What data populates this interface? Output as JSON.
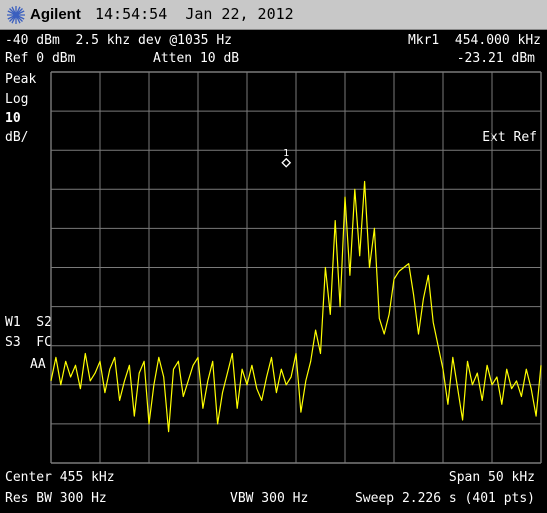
{
  "titlebar": {
    "brand": "Agilent",
    "time": "14:54:54",
    "date": "Jan 22, 2012",
    "logo_icon": "agilent-spark-icon"
  },
  "header": {
    "line1_left": "-40 dBm  2.5 khz dev @1035 Hz",
    "marker_label": "Mkr1  454.000 kHz",
    "ref_level": "Ref 0 dBm",
    "attenuation": "Atten 10 dB",
    "marker_amplitude": "-23.21 dBm"
  },
  "left_panel": {
    "detector": "Peak",
    "scale_type": "Log",
    "scale_value": "10",
    "scale_unit": "dB/",
    "trace_line1": "W1  S2",
    "trace_line2": "S3  FC",
    "trace_line3": "AA"
  },
  "right_panel": {
    "reference": "Ext Ref"
  },
  "marker": {
    "number": "1",
    "frequency_khz": 454.0,
    "amplitude_dbm": -23.21
  },
  "footer": {
    "center": "Center 455 kHz",
    "span": "Span 50 kHz",
    "rbw": "Res BW 300 Hz",
    "vbw": "VBW 300 Hz",
    "sweep": "Sweep 2.226 s (401 pts)"
  },
  "colors": {
    "trace": "#ffff00",
    "grid": "#7a7a7a",
    "background": "#000000",
    "titlebar": "#c8c8c8"
  },
  "chart_data": {
    "type": "line",
    "x_unit": "kHz",
    "y_unit": "dBm",
    "xlim": [
      430,
      480
    ],
    "ylim": [
      -100,
      0
    ],
    "x_divisions": 10,
    "y_divisions": 10,
    "grid": true,
    "series": [
      {
        "x": [
          430.0,
          430.5,
          431.0,
          431.5,
          432.0,
          432.5,
          433.0,
          433.5,
          434.0,
          434.5,
          435.0,
          435.5,
          436.0,
          436.5,
          437.0,
          437.5,
          438.0,
          438.5,
          439.0,
          439.5,
          440.0,
          440.5,
          441.0,
          441.5,
          442.0,
          442.5,
          443.0,
          443.5,
          444.0,
          444.5,
          445.0,
          445.5,
          446.0,
          446.5,
          447.0,
          447.5,
          448.0,
          448.5,
          449.0,
          449.5,
          450.0,
          450.5,
          451.0,
          451.5,
          452.0,
          452.5,
          453.0,
          453.5,
          454.0,
          454.5,
          455.0,
          455.5,
          456.0,
          456.5,
          457.0,
          457.5,
          458.0,
          458.5,
          459.0,
          459.5,
          460.0,
          460.5,
          461.0,
          461.5,
          462.0,
          462.5,
          463.0,
          463.5,
          464.0,
          464.5,
          465.0,
          465.5,
          466.0,
          466.5,
          467.0,
          467.5,
          468.0,
          468.5,
          469.0,
          469.5,
          470.0,
          470.5,
          471.0,
          471.5,
          472.0,
          472.5,
          473.0,
          473.5,
          474.0,
          474.5,
          475.0,
          475.5,
          476.0,
          476.5,
          477.0,
          477.5,
          478.0,
          478.5,
          479.0,
          479.5,
          480.0
        ],
        "y": [
          -79,
          -73,
          -80,
          -74,
          -78,
          -75,
          -81,
          -72,
          -79,
          -77,
          -74,
          -82,
          -76,
          -73,
          -84,
          -79,
          -75,
          -88,
          -77,
          -74,
          -90,
          -80,
          -73,
          -78,
          -92,
          -76,
          -74,
          -83,
          -79,
          -75,
          -73,
          -86,
          -79,
          -74,
          -90,
          -82,
          -77,
          -72,
          -86,
          -76,
          -80,
          -75,
          -81,
          -84,
          -78,
          -73,
          -82,
          -76,
          -80,
          -78,
          -72,
          -87,
          -79,
          -74,
          -66,
          -72,
          -50,
          -62,
          -38,
          -60,
          -32,
          -52,
          -30,
          -47,
          -28,
          -50,
          -40,
          -63,
          -67,
          -62,
          -53,
          -51,
          -50,
          -49,
          -57,
          -67,
          -58,
          -52,
          -64,
          -70,
          -76,
          -85,
          -73,
          -81,
          -89,
          -74,
          -80,
          -77,
          -84,
          -75,
          -80,
          -78,
          -85,
          -76,
          -81,
          -79,
          -83,
          -76,
          -81,
          -88,
          -75
        ]
      }
    ]
  }
}
